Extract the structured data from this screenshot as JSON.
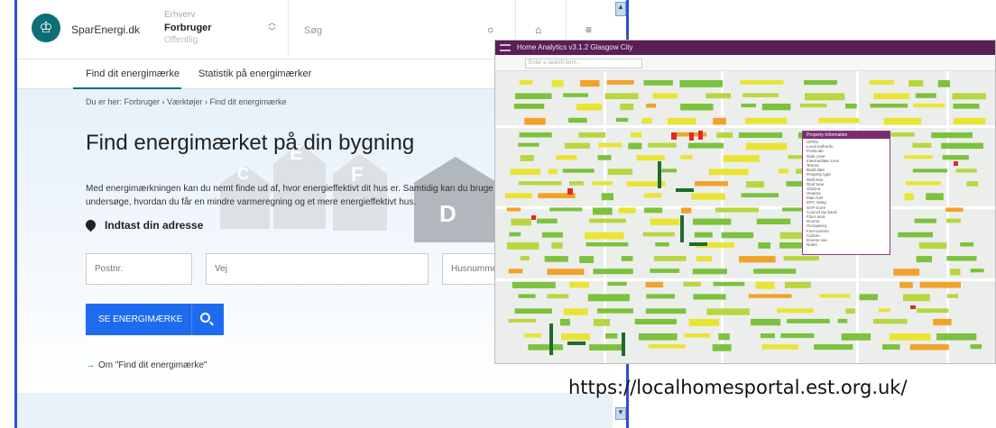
{
  "site": {
    "brand": "SparEnergi.dk",
    "segments": [
      "Erhverv",
      "Forbruger",
      "Offentlig"
    ],
    "search_label": "Søg",
    "tabs": [
      "Find dit energimærke",
      "Statistik på energimærker"
    ],
    "breadcrumb": "Du er her: Forbruger › Værktøjer › Find dit energimærke",
    "title": "Find energimærket på din bygning",
    "intro_line1": "Med energimærkningen kan du nemt finde ud af, hvor energieffektivt dit hus er. Samtidig kan du bruge",
    "intro_line2": "undersøge, hvordan du får en mindre varmeregning og et mere energieffektivt hus.",
    "address_heading": "Indtast din adresse",
    "fields": {
      "postnr": "Postnr.",
      "vej": "Vej",
      "husnummer": "Husnummer"
    },
    "button_label": "SE ENERGIMÆRKE",
    "about_link": "Om \"Find dit energimærke\"",
    "house_letters": [
      "C",
      "E",
      "F",
      "D"
    ]
  },
  "map_app": {
    "title": "Home Analytics v3.1.2 Glasgow City",
    "search_placeholder": "Enter a search term...",
    "panel_title": "Property Information",
    "panel_rows": [
      "UPRN",
      "Local authority",
      "Postcode",
      "Data zone",
      "Intermediate zone",
      "Tenure",
      "Build date",
      "Property type",
      "Wall type",
      "Roof type",
      "Glazing",
      "Heating",
      "Main fuel",
      "EPC rating",
      "SAP score",
      "Council tax band",
      "Floor area",
      "Rooms",
      "Occupancy",
      "Fuel poverty",
      "Carbon",
      "Energy use",
      "Notes"
    ],
    "colors": {
      "green": "#7cc23d",
      "light_green": "#b8d640",
      "yellow": "#e9e434",
      "orange": "#f2a22a",
      "red": "#e02b20",
      "dark_green": "#1f6b2a",
      "title_bar": "#5a1f54"
    }
  },
  "caption": "https://localhomesportal.est.org.uk/"
}
